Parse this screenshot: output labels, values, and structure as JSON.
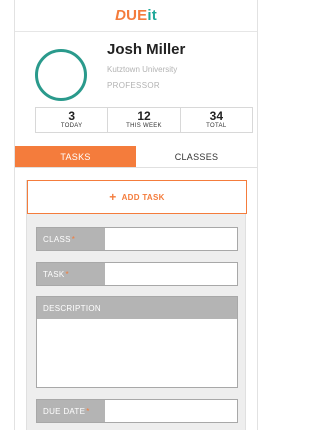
{
  "logo": {
    "d": "D",
    "ue": "UE",
    "it": "it"
  },
  "profile": {
    "name": "Josh Miller",
    "university": "Kutztown University",
    "role": "PROFESSOR"
  },
  "stats": [
    {
      "number": "3",
      "label": "TODAY"
    },
    {
      "number": "12",
      "label": "THIS WEEK"
    },
    {
      "number": "34",
      "label": "TOTAL"
    }
  ],
  "tabs": {
    "tasks": "TASKS",
    "classes": "CLASSES"
  },
  "form": {
    "add_task": "ADD TASK",
    "class_label": "CLASS",
    "task_label": "TASK",
    "description_label": "DESCRIPTION",
    "due_date_label": "DUE DATE",
    "required_mark": "*"
  },
  "colors": {
    "accent": "#f47c3c",
    "teal": "#2a9a8c"
  }
}
